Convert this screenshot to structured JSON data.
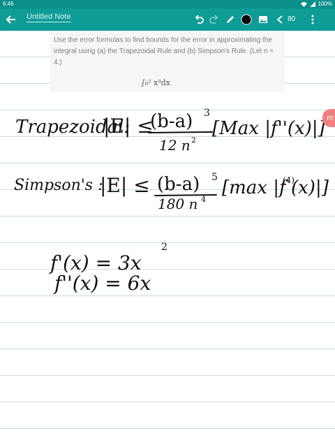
{
  "status": {
    "time": "6:46",
    "battery": "100%"
  },
  "toolbar": {
    "title": "Untitled Note",
    "page_count": "80",
    "icons": [
      "back-arrow-icon",
      "undo-icon",
      "redo-icon",
      "pen-icon",
      "color-swatch-icon",
      "image-icon",
      "share-icon",
      "more-vert-icon"
    ],
    "accent": "#0f9c97"
  },
  "question": {
    "text": "Use the error formulas to find bounds for the error in approximating the integral using (a) the Trapezoidal Rule and (b) Simpson's Rule. (Let n = 4.)",
    "integral": "∫₀² x³dx"
  },
  "handwriting": {
    "trap_label": "Trapezoidal:",
    "trap_bound": "|E| ≤",
    "trap_num": "(b-a)",
    "trap_num_exp": "3",
    "trap_den": "12 n",
    "trap_den_exp": "2",
    "trap_max": "[Max |f''(x)|]",
    "simp_label": "Simpson's :",
    "simp_bound": "|E| ≤",
    "simp_num": "(b-a)",
    "simp_num_exp": "5",
    "simp_den": "180 n",
    "simp_den_exp": "4",
    "simp_max": "[max |f",
    "simp_max_exp": "(4)",
    "simp_max_end": "(x)|]",
    "d1": "f'(x) = 3x",
    "d1_exp": "2",
    "d2": "f''(x) = 6x"
  },
  "side_tab": {
    "label": "m"
  }
}
